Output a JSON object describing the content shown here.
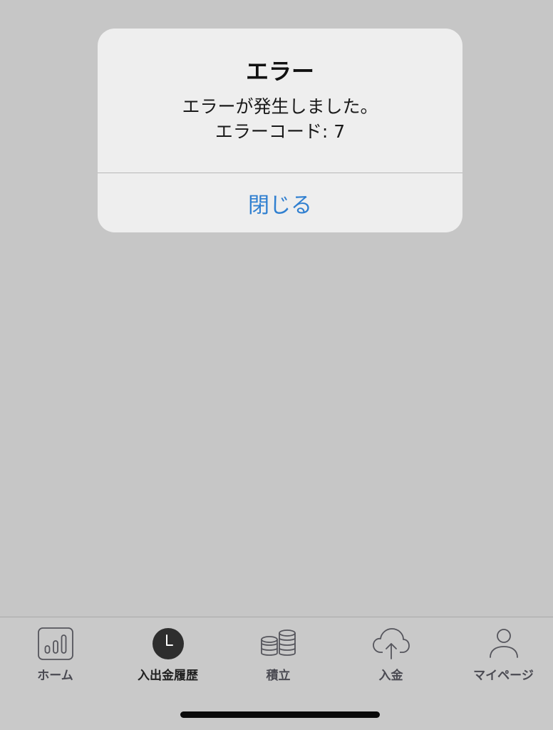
{
  "alert": {
    "title": "エラー",
    "message_line1": "エラーが発生しました。",
    "message_line2": "エラーコード: 7",
    "close_label": "閉じる"
  },
  "tabbar": {
    "items": [
      {
        "label": "ホーム",
        "icon": "chart-bars-icon"
      },
      {
        "label": "入出金履歴",
        "icon": "clock-icon",
        "active": true
      },
      {
        "label": "積立",
        "icon": "coin-stack-icon"
      },
      {
        "label": "入金",
        "icon": "cloud-upload-icon"
      },
      {
        "label": "マイページ",
        "icon": "person-icon"
      }
    ]
  },
  "colors": {
    "background": "#c6c6c6",
    "alert_bg": "#eeeeee",
    "accent": "#2f7fd0",
    "tab_label": "#4a4a52"
  }
}
